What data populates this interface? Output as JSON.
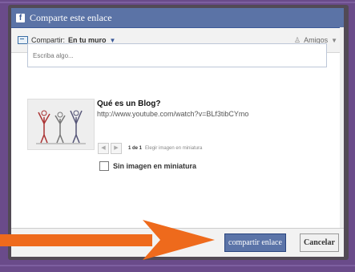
{
  "dialog": {
    "title": "Comparte este enlace",
    "brand_letter": "f"
  },
  "sharebar": {
    "share_label": "Compartir:",
    "destination": "En tu muro",
    "audience": "Amigos"
  },
  "composer": {
    "placeholder": "Escriba algo..."
  },
  "link_preview": {
    "title": "Qué es un Blog?",
    "url": "http://www.youtube.com/watch?v=BLf3tibCYmo",
    "page_count": "1 de 1",
    "choose_thumbnail": "Elegir imagen en miniatura",
    "no_thumbnail_label": "Sin imagen en miniatura"
  },
  "footer": {
    "share_button": "compartir enlace",
    "cancel_button": "Cancelar"
  },
  "colors": {
    "accent": "#5b74a8",
    "arrow": "#ee6a1c",
    "background": "#6a4b8a"
  },
  "icons": [
    "facebook-logo-icon",
    "share-link-icon",
    "chevron-down-icon",
    "people-icon",
    "prev-icon",
    "next-icon",
    "arrow-icon"
  ]
}
